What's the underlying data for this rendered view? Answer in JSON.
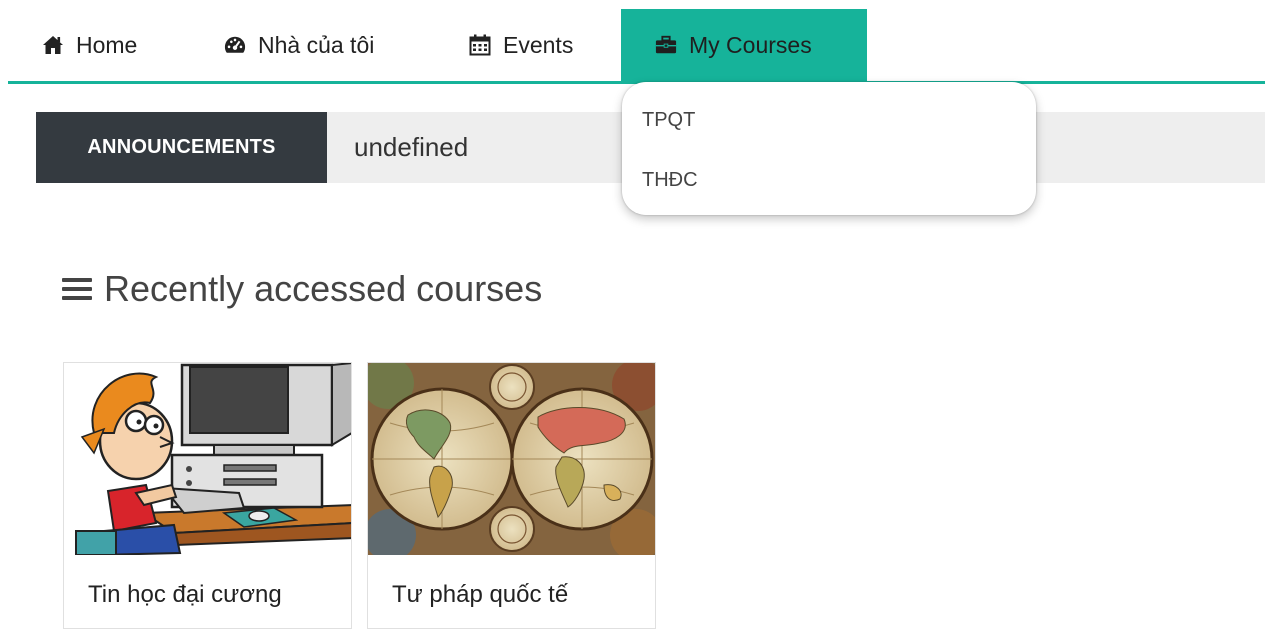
{
  "nav": {
    "items": [
      {
        "label": "Home",
        "icon": "home-icon"
      },
      {
        "label": "Nhà của tôi",
        "icon": "dashboard-icon"
      },
      {
        "label": "Events",
        "icon": "calendar-icon"
      },
      {
        "label": "My Courses",
        "icon": "briefcase-icon"
      }
    ],
    "accent_color": "#16b39a"
  },
  "announcements": {
    "tag": "ANNOUNCEMENTS",
    "text": "undefined"
  },
  "dropdown": {
    "items": [
      "TPQT",
      "THĐC"
    ]
  },
  "recent": {
    "title": "Recently accessed courses",
    "courses": [
      {
        "name": "Tin học đại cương",
        "image": "computer-cartoon"
      },
      {
        "name": "Tư pháp quốc tế",
        "image": "world-map"
      }
    ]
  }
}
